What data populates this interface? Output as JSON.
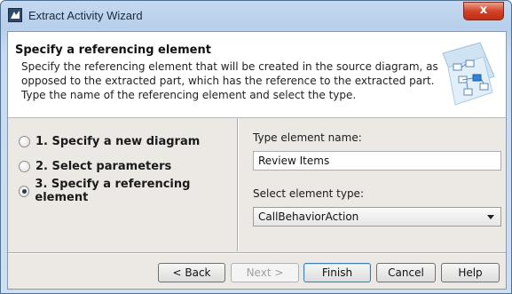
{
  "window": {
    "title": "Extract Activity Wizard",
    "close_glyph": "x"
  },
  "header": {
    "title": "Specify a referencing element",
    "description_lines": [
      "Specify the referencing element that will be created in the source diagram, as",
      "opposed to the extracted part, which has the reference to the extracted part.",
      "Type the name of the referencing element and select the type."
    ]
  },
  "steps": [
    {
      "label": "1. Specify a new diagram",
      "selected": false
    },
    {
      "label": "2. Select parameters",
      "selected": false
    },
    {
      "label": "3. Specify a referencing element",
      "selected": true
    }
  ],
  "form": {
    "name_label": "Type element name:",
    "name_value": "Review Items",
    "type_label": "Select element type:",
    "type_value": "CallBehaviorAction"
  },
  "buttons": {
    "back": "< Back",
    "next": "Next >",
    "finish": "Finish",
    "cancel": "Cancel",
    "help": "Help"
  },
  "colors": {
    "titlebar": "#c5daf1",
    "close": "#c12d14",
    "panel": "#ece9e4"
  }
}
